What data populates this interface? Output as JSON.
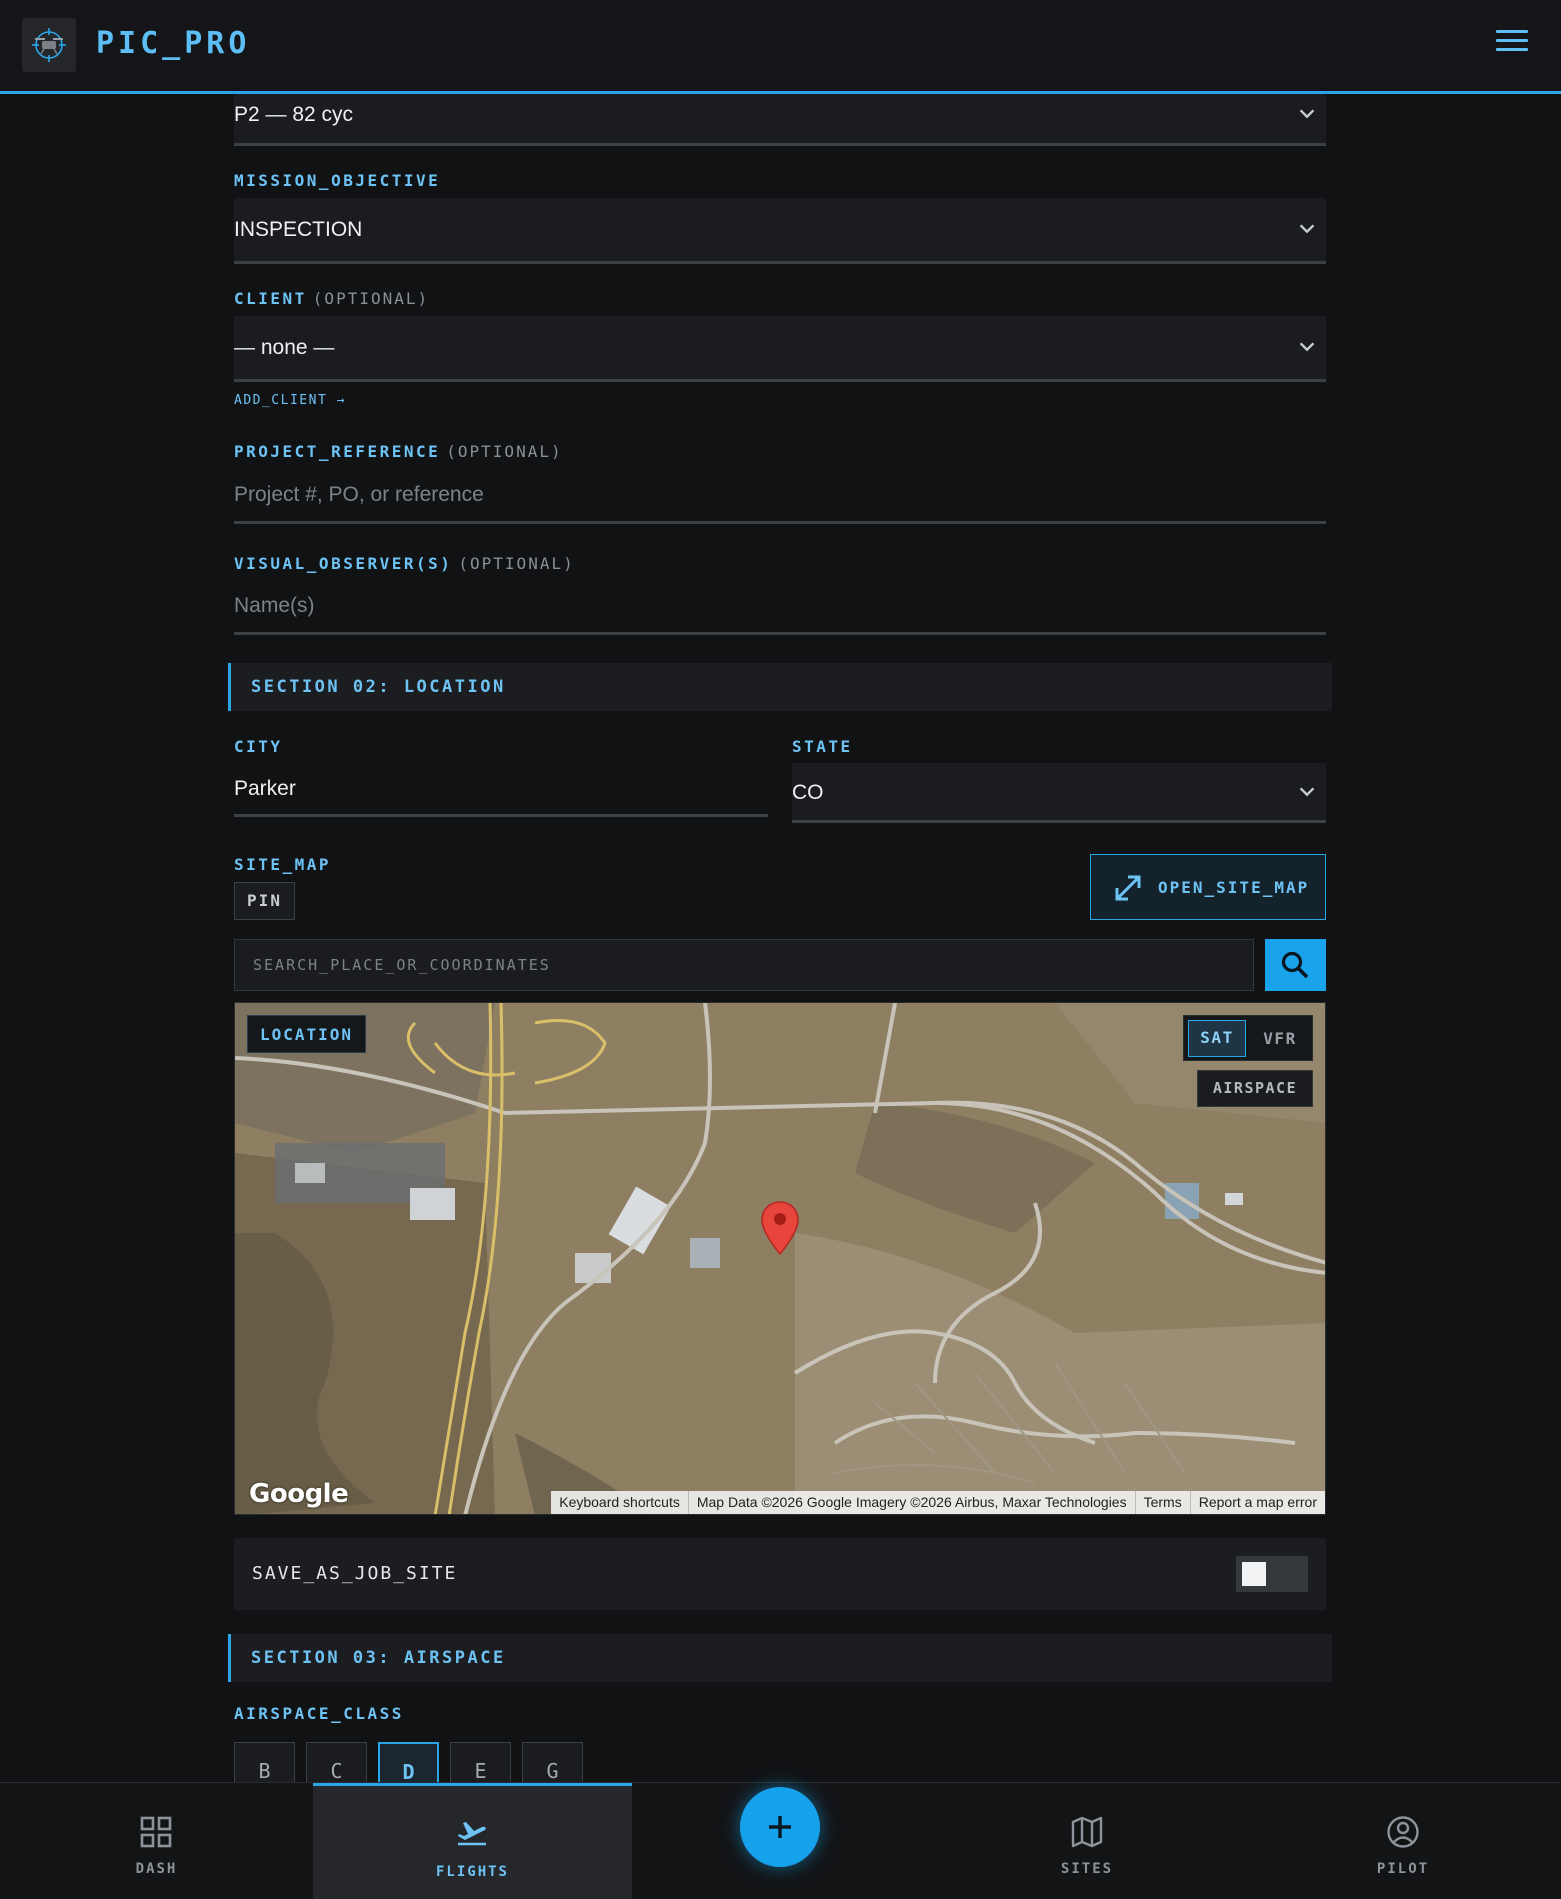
{
  "header": {
    "app_title": "PIC_PRO",
    "logo_icon": "drone-logo-icon",
    "menu_icon": "hamburger-menu-icon"
  },
  "form": {
    "battery": {
      "value": "P2 — 82 cyc"
    },
    "mission_objective": {
      "label": "MISSION_OBJECTIVE",
      "value": "INSPECTION"
    },
    "client": {
      "label": "CLIENT",
      "optional": "(OPTIONAL)",
      "value": "— none —",
      "add_link": "ADD_CLIENT →"
    },
    "project_reference": {
      "label": "PROJECT_REFERENCE",
      "optional": "(OPTIONAL)",
      "placeholder": "Project #, PO, or reference",
      "value": ""
    },
    "visual_observers": {
      "label": "VISUAL_OBSERVER(S)",
      "optional": "(OPTIONAL)",
      "placeholder": "Name(s)",
      "value": ""
    }
  },
  "section_location": {
    "title": "SECTION 02: LOCATION",
    "city": {
      "label": "CITY",
      "value": "Parker"
    },
    "state": {
      "label": "STATE",
      "value": "CO"
    },
    "site_map": {
      "label": "SITE_MAP",
      "badge": "PIN",
      "open_button": "OPEN_SITE_MAP"
    },
    "search": {
      "placeholder": "SEARCH_PLACE_OR_COORDINATES",
      "value": ""
    },
    "map": {
      "location_chip": "LOCATION",
      "layer_sat": "SAT",
      "layer_vfr": "VFR",
      "airspace_button": "AIRSPACE",
      "google_logo": "Google",
      "attribution": [
        "Keyboard shortcuts",
        "Map Data ©2026 Google Imagery ©2026 Airbus, Maxar Technologies",
        "Terms",
        "Report a map error"
      ]
    },
    "save_as_job_site": {
      "label": "SAVE_AS_JOB_SITE",
      "on": false
    }
  },
  "section_airspace": {
    "title": "SECTION 03: AIRSPACE",
    "class_label": "AIRSPACE_CLASS",
    "classes": [
      "B",
      "C",
      "D",
      "E",
      "G"
    ],
    "selected": "D"
  },
  "bottom_nav": {
    "items": [
      {
        "label": "DASH",
        "icon": "grid-icon"
      },
      {
        "label": "FLIGHTS",
        "icon": "plane-takeoff-icon"
      },
      {
        "label": "SITES",
        "icon": "map-icon"
      },
      {
        "label": "PILOT",
        "icon": "user-circle-icon"
      }
    ],
    "active": "FLIGHTS",
    "fab_icon": "plus-icon"
  },
  "colors": {
    "accent": "#2aa5e8",
    "accent_text": "#6ec3f5",
    "background": "#111214",
    "panel": "#1c1d20"
  }
}
